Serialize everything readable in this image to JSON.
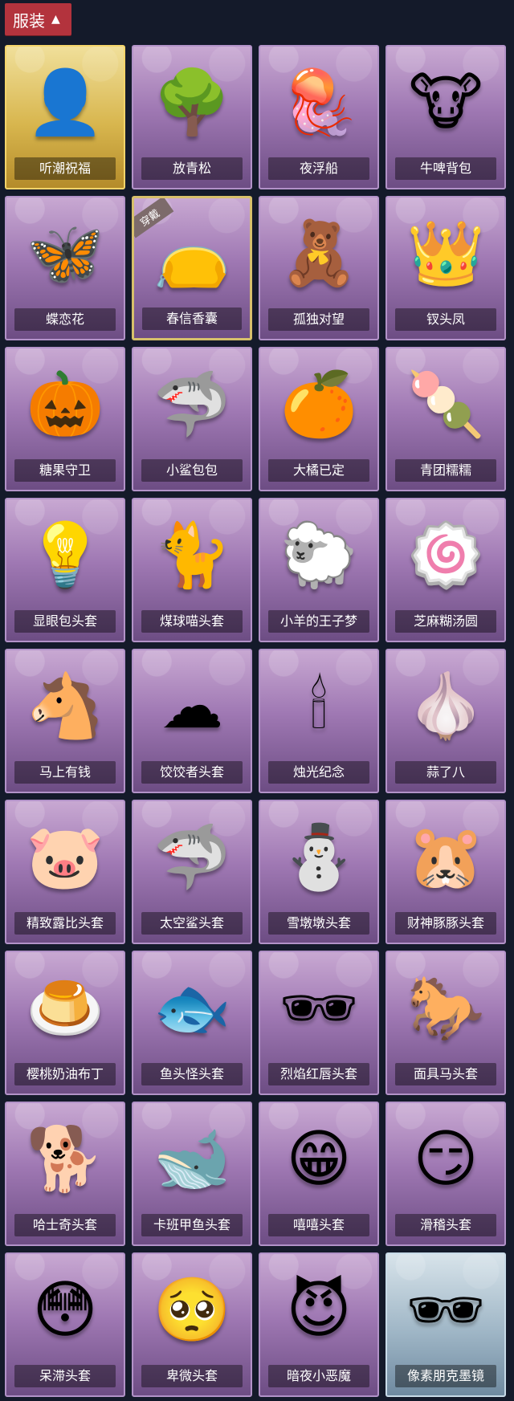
{
  "header": {
    "tab_label": "服装"
  },
  "items": [
    {
      "name": "听潮祝福",
      "icon": "mannequin-icon",
      "style": "gold",
      "badge": ""
    },
    {
      "name": "放青松",
      "icon": "bonsai-pine-icon",
      "style": "",
      "badge": ""
    },
    {
      "name": "夜浮船",
      "icon": "jellyfish-icon",
      "style": "",
      "badge": ""
    },
    {
      "name": "牛啤背包",
      "icon": "cow-beer-backpack-icon",
      "style": "",
      "badge": ""
    },
    {
      "name": "蝶恋花",
      "icon": "butterfly-wreath-icon",
      "style": "",
      "badge": ""
    },
    {
      "name": "春信香囊",
      "icon": "sachet-icon",
      "style": "selected",
      "badge": "穿戴"
    },
    {
      "name": "孤独对望",
      "icon": "figure-charm-icon",
      "style": "",
      "badge": ""
    },
    {
      "name": "钗头凤",
      "icon": "phoenix-crown-icon",
      "style": "",
      "badge": ""
    },
    {
      "name": "糖果守卫",
      "icon": "pumpkin-scarecrow-icon",
      "style": "",
      "badge": ""
    },
    {
      "name": "小鲨包包",
      "icon": "shark-bag-icon",
      "style": "",
      "badge": ""
    },
    {
      "name": "大橘已定",
      "icon": "orange-slice-icon",
      "style": "",
      "badge": ""
    },
    {
      "name": "青团糯糯",
      "icon": "green-rice-ball-icon",
      "style": "",
      "badge": ""
    },
    {
      "name": "显眼包头套",
      "icon": "lightbulb-mask-icon",
      "style": "",
      "badge": ""
    },
    {
      "name": "煤球喵头套",
      "icon": "black-cat-mask-icon",
      "style": "",
      "badge": ""
    },
    {
      "name": "小羊的王子梦",
      "icon": "sheep-crown-mask-icon",
      "style": "",
      "badge": ""
    },
    {
      "name": "芝麻糊汤圆",
      "icon": "dumpling-mask-icon",
      "style": "",
      "badge": ""
    },
    {
      "name": "马上有钱",
      "icon": "horse-mask-icon",
      "style": "",
      "badge": ""
    },
    {
      "name": "饺饺者头套",
      "icon": "dumpling-cloud-mask-icon",
      "style": "",
      "badge": ""
    },
    {
      "name": "烛光纪念",
      "icon": "candle-mask-icon",
      "style": "",
      "badge": ""
    },
    {
      "name": "蒜了八",
      "icon": "garlic-mask-icon",
      "style": "",
      "badge": ""
    },
    {
      "name": "精致露比头套",
      "icon": "ruby-mask-icon",
      "style": "",
      "badge": ""
    },
    {
      "name": "太空鲨头套",
      "icon": "space-shark-mask-icon",
      "style": "",
      "badge": ""
    },
    {
      "name": "雪墩墩头套",
      "icon": "snowman-mask-icon",
      "style": "",
      "badge": ""
    },
    {
      "name": "财神豚豚头套",
      "icon": "capybara-god-mask-icon",
      "style": "",
      "badge": ""
    },
    {
      "name": "樱桃奶油布丁",
      "icon": "pudding-mask-icon",
      "style": "",
      "badge": ""
    },
    {
      "name": "鱼头怪头套",
      "icon": "fish-head-mask-icon",
      "style": "",
      "badge": ""
    },
    {
      "name": "烈焰红唇头套",
      "icon": "red-lips-mask-icon",
      "style": "",
      "badge": ""
    },
    {
      "name": "面具马头套",
      "icon": "horse-head-mask-icon",
      "style": "",
      "badge": ""
    },
    {
      "name": "哈士奇头套",
      "icon": "husky-mask-icon",
      "style": "",
      "badge": ""
    },
    {
      "name": "卡班甲鱼头套",
      "icon": "fish-cap-mask-icon",
      "style": "",
      "badge": ""
    },
    {
      "name": "嘻嘻头套",
      "icon": "grin-emoji-mask-icon",
      "style": "",
      "badge": ""
    },
    {
      "name": "滑稽头套",
      "icon": "funny-face-mask-icon",
      "style": "",
      "badge": ""
    },
    {
      "name": "呆滞头套",
      "icon": "dazed-emoji-mask-icon",
      "style": "",
      "badge": ""
    },
    {
      "name": "卑微头套",
      "icon": "humble-emoji-mask-icon",
      "style": "",
      "badge": ""
    },
    {
      "name": "暗夜小恶魔",
      "icon": "devil-mannequin-icon",
      "style": "",
      "badge": ""
    },
    {
      "name": "像素朋克墨镜",
      "icon": "pixel-sunglasses-icon",
      "style": "blue",
      "badge": ""
    }
  ]
}
